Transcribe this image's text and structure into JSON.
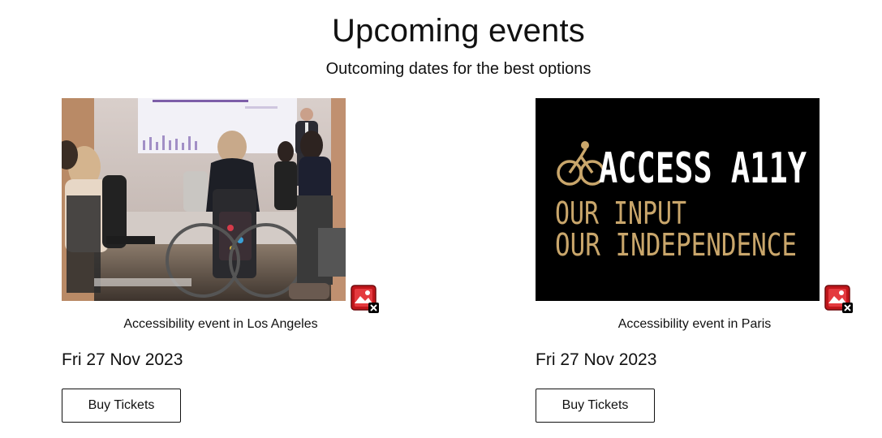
{
  "header": {
    "title": "Upcoming events",
    "subtitle": "Outcoming dates for the best options"
  },
  "events": [
    {
      "image_icon": "broken-image-icon",
      "caption": "Accessibility event in Los Angeles",
      "date": "Fri 27 Nov 2023",
      "button_label": "Buy Tickets"
    },
    {
      "image_icon": "broken-image-icon",
      "logo_title": "ACCESS A11Y",
      "logo_line1": "OUR INPUT",
      "logo_line2": "OUR INDEPENDENCE",
      "caption": "Accessibility event in Paris",
      "date": "Fri 27 Nov 2023",
      "button_label": "Buy Tickets"
    }
  ],
  "colors": {
    "logo_bg": "#000000",
    "logo_gold": "#c9a66b",
    "logo_white": "#ffffff",
    "broken_icon": "#c0161b"
  }
}
